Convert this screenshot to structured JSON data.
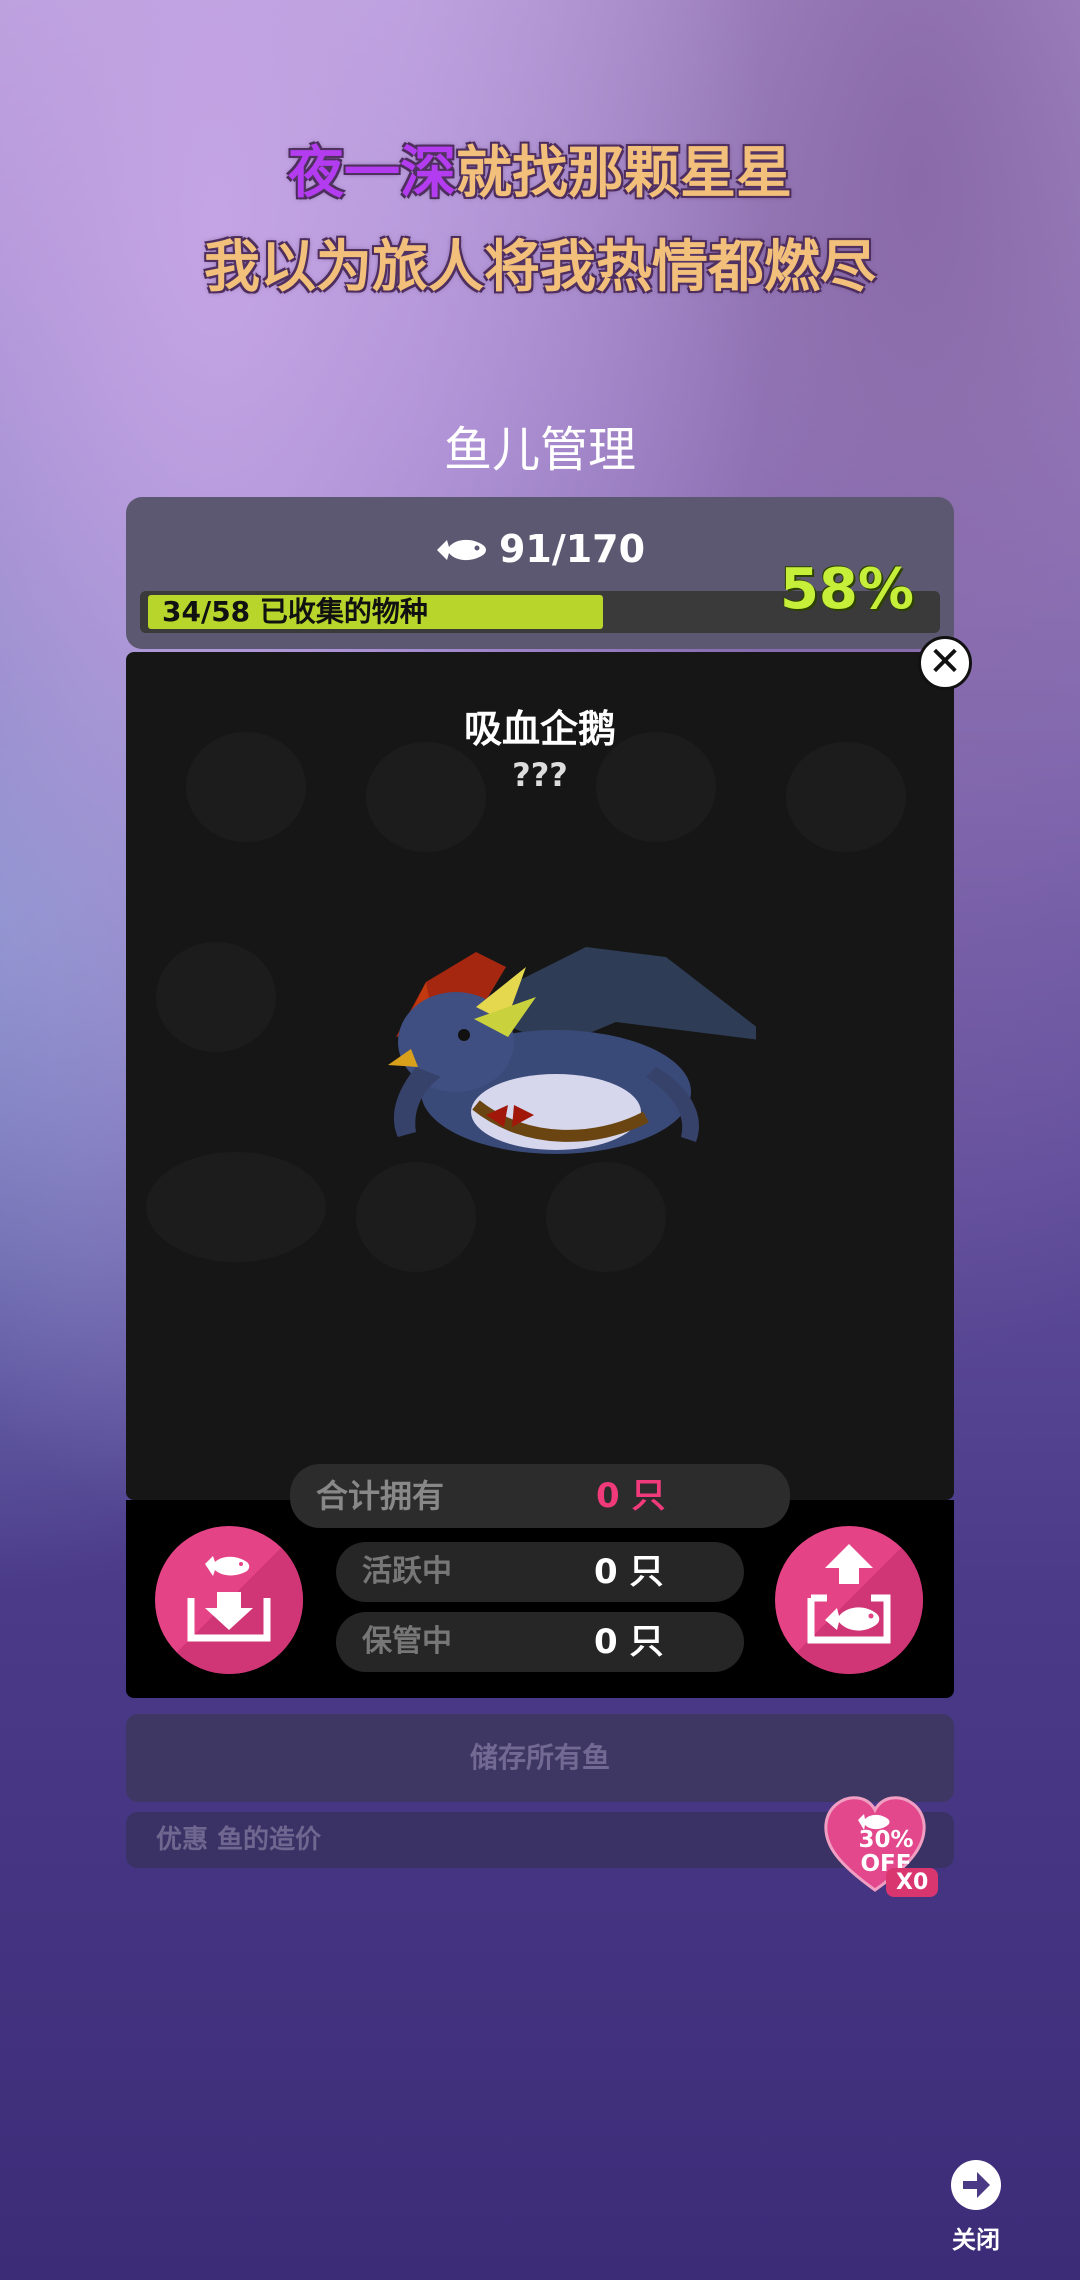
{
  "lyrics": {
    "line1_highlight": "夜一深",
    "line1_rest": "就找那颗星星",
    "line2": "我以为旅人将我热情都燃尽"
  },
  "page_title": "鱼儿管理",
  "stats": {
    "fish_count": "91/170",
    "species_label": "34/58 已收集的物种",
    "species_progress": 0.58,
    "percent": "58%"
  },
  "fish": {
    "name": "吸血企鹅",
    "description": "???"
  },
  "counts": {
    "total_label": "合计拥有",
    "total_value": "0 只",
    "active_label": "活跃中",
    "active_value": "0 只",
    "stored_label": "保管中",
    "stored_value": "0 只"
  },
  "buttons": {
    "store_all": "储存所有鱼",
    "discount_label": "优惠 鱼的造价",
    "discount_badge_pct": "30%",
    "discount_badge_off": "OFF",
    "discount_count": "X0",
    "close_label": "关闭"
  },
  "colors": {
    "accent_pink": "#e44386",
    "progress_green": "#b8d52c",
    "percent_green": "#c6ef3a",
    "total_value_pink": "#f03a7a"
  },
  "icons": [
    "fish-icon",
    "store-fish-icon",
    "release-fish-icon",
    "close-icon",
    "heart-discount-icon",
    "arrow-right-icon"
  ]
}
